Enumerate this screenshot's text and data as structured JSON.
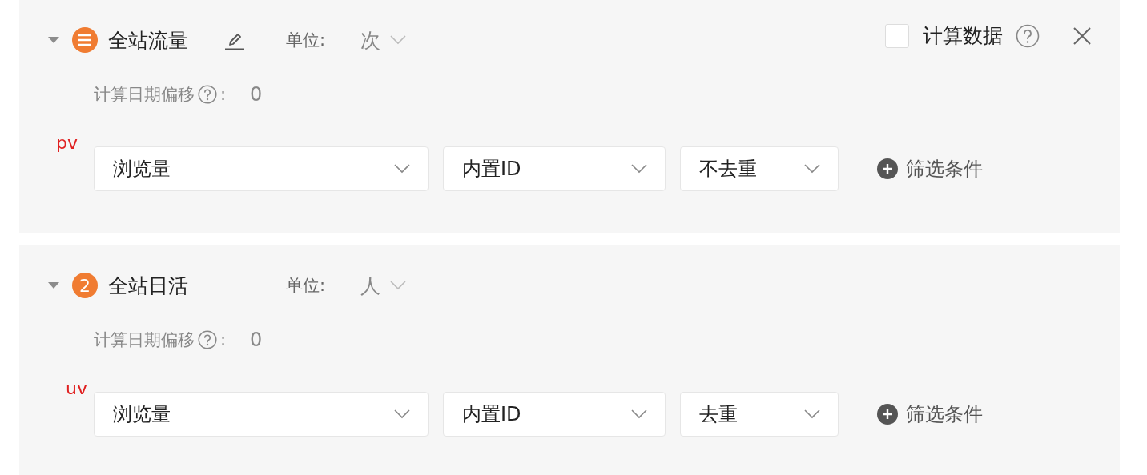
{
  "metrics": [
    {
      "expanded": true,
      "badge": {
        "kind": "lines"
      },
      "title": "全站流量",
      "editable": true,
      "unit_label": "单位:",
      "unit": "次",
      "calc": {
        "label": "计算数据",
        "checked": false
      },
      "closable": true,
      "offset_label": "计算日期偏移",
      "offset_colon": ":",
      "offset_value": "0",
      "annotation": "pv",
      "selects": [
        "浏览量",
        "内置ID",
        "不去重"
      ],
      "filter_label": "筛选条件"
    },
    {
      "expanded": true,
      "badge": {
        "kind": "number",
        "text": "2"
      },
      "title": "全站日活",
      "editable": false,
      "unit_label": "单位:",
      "unit": "人",
      "closable": false,
      "offset_label": "计算日期偏移",
      "offset_colon": ":",
      "offset_value": "0",
      "annotation": "uv",
      "selects": [
        "浏览量",
        "内置ID",
        "去重"
      ],
      "filter_label": "筛选条件"
    }
  ]
}
